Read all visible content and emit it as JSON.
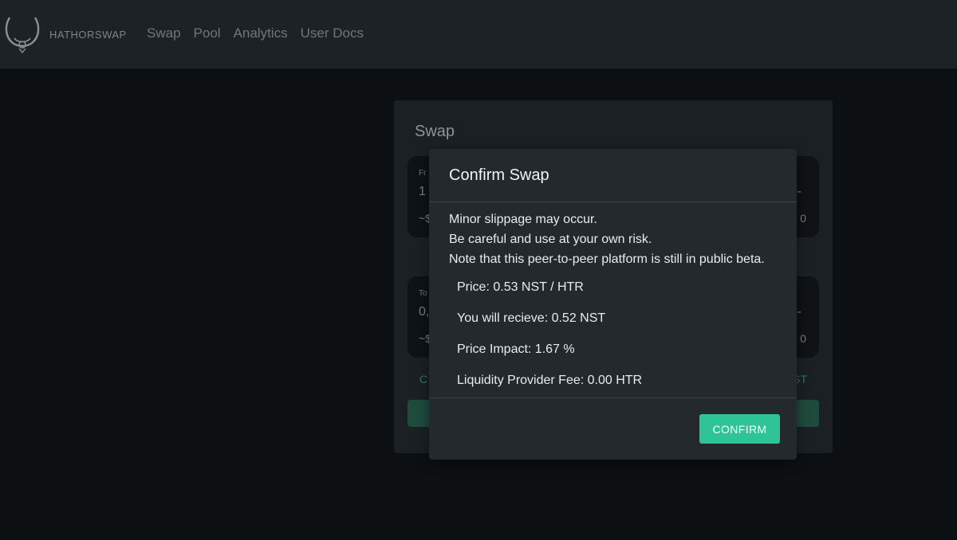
{
  "navbar": {
    "brand": "HATHORSWAP",
    "links": [
      "Swap",
      "Pool",
      "Analytics",
      "User Docs"
    ]
  },
  "swap_card": {
    "title": "Swap",
    "from_box": {
      "label": "Fr",
      "amount": "1",
      "usd": "~$",
      "right_top": "-",
      "right_bottom": "0"
    },
    "to_box": {
      "label": "To",
      "amount": "0,",
      "usd": "~$",
      "right_top": "-",
      "right_bottom": "0"
    },
    "left_green": "C",
    "right_green": "ST"
  },
  "modal": {
    "title": "Confirm Swap",
    "warnings": [
      "Minor slippage may occur.",
      "Be careful and use at your own risk.",
      "Note that this peer-to-peer platform is still in public beta."
    ],
    "details": {
      "price": "Price: 0.53 NST / HTR",
      "receive": "You will recieve: 0.52 NST",
      "impact": "Price Impact: 1.67 %",
      "fee": "Liquidity Provider Fee: 0.00 HTR"
    },
    "confirm_label": "CONFIRM"
  },
  "colors": {
    "accent": "#2fc498",
    "page_background": "#0d1013",
    "navbar_background": "#1d2226",
    "modal_background": "#23292d"
  }
}
